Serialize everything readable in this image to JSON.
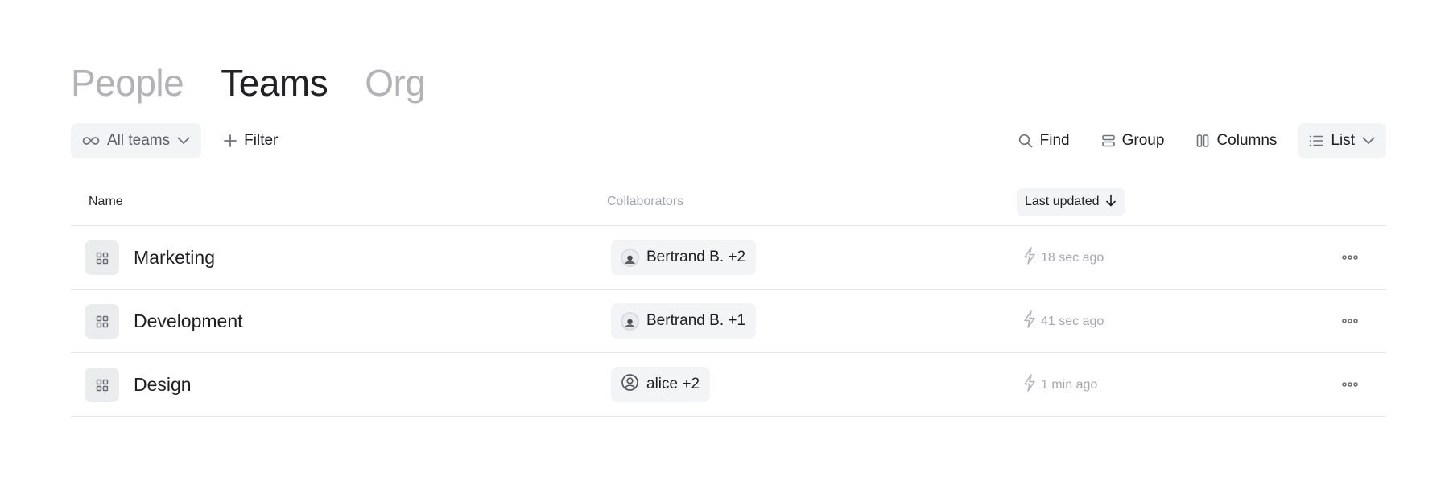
{
  "tabs": [
    "People",
    "Teams",
    "Org"
  ],
  "active_tab": "Teams",
  "toolbar": {
    "scope_label": "All teams",
    "filter_label": "Filter",
    "find_label": "Find",
    "group_label": "Group",
    "columns_label": "Columns",
    "view_label": "List"
  },
  "table": {
    "headers": {
      "name": "Name",
      "collaborators": "Collaborators",
      "last_updated": "Last updated"
    },
    "sort": {
      "column": "last_updated",
      "direction": "descending"
    },
    "rows": [
      {
        "name": "Marketing",
        "collaborators": "Bertrand B. +2",
        "collaborator_icon": "user-photo-avatar",
        "updated": "18 sec ago"
      },
      {
        "name": "Development",
        "collaborators": "Bertrand B. +1",
        "collaborator_icon": "user-photo-avatar",
        "updated": "41 sec ago"
      },
      {
        "name": "Design",
        "collaborators": "alice +2",
        "collaborator_icon": "user-circle-icon",
        "updated": "1 min ago"
      }
    ]
  },
  "icons": {
    "scope": "infinity-icon",
    "scope_caret": "chevron-down-icon",
    "filter": "plus-icon",
    "find": "search-icon",
    "group": "group-rows-icon",
    "columns": "columns-icon",
    "view": "list-icon",
    "view_caret": "chevron-down-icon",
    "sort": "arrow-down-icon",
    "team": "grid-icon",
    "updated": "lightning-icon",
    "row_menu": "more-horizontal-icon"
  },
  "colors": {
    "tab_active": "#222224",
    "tab_inactive": "#b2b2b7",
    "chip_bg": "#f3f4f6",
    "row_border": "#e6e6ea",
    "muted_text": "#a5a7ad"
  }
}
